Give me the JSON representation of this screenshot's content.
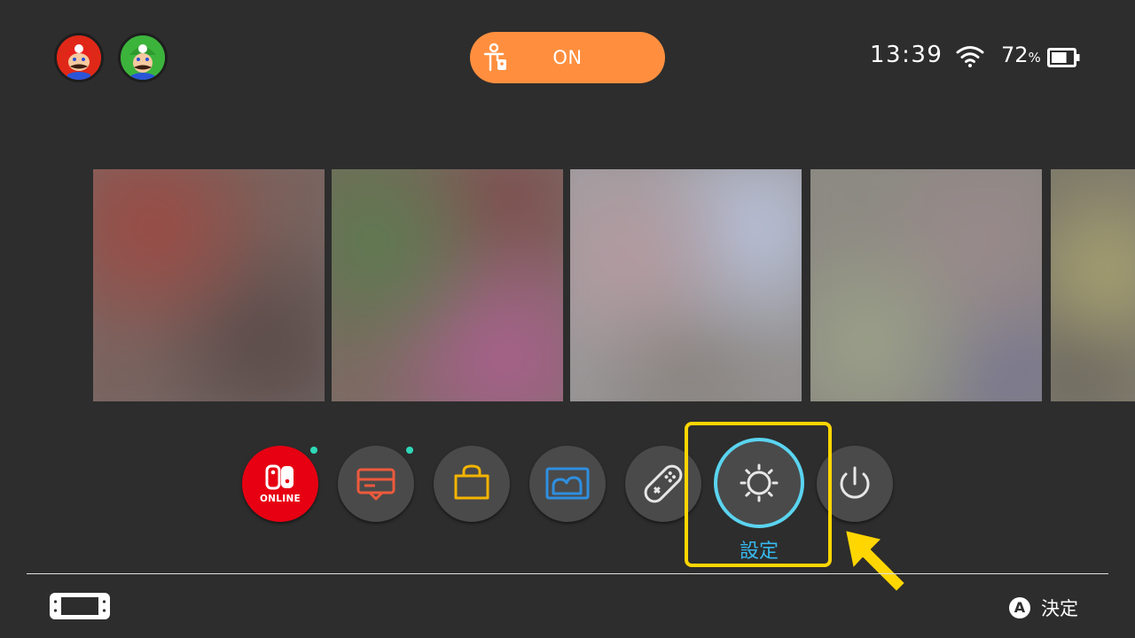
{
  "users": [
    {
      "name": "mario-avatar",
      "color": "#e02818"
    },
    {
      "name": "luigi-avatar",
      "color": "#3cb43c"
    }
  ],
  "parental_controls": {
    "label": "ON",
    "icon": "parental-controls-icon",
    "color": "#ff8f3f"
  },
  "status": {
    "time": "13:39",
    "battery_percent": "72",
    "battery_unit": "%",
    "battery_level": 0.72
  },
  "games": [
    {
      "name": "game-tile-1"
    },
    {
      "name": "game-tile-2"
    },
    {
      "name": "game-tile-3"
    },
    {
      "name": "game-tile-4"
    },
    {
      "name": "game-tile-5"
    }
  ],
  "dock": {
    "online": {
      "label": "ONLINE",
      "icon": "nintendo-switch-online-icon",
      "has_notice": true
    },
    "news": {
      "icon": "news-icon",
      "has_notice": true
    },
    "eshop": {
      "icon": "shopping-bag-icon"
    },
    "album": {
      "icon": "album-icon"
    },
    "controllers": {
      "icon": "controller-icon"
    },
    "settings": {
      "label": "設定",
      "icon": "gear-icon",
      "selected": true
    },
    "power": {
      "icon": "power-icon"
    }
  },
  "footer": {
    "console_icon": "console-icon",
    "confirm_button": "A",
    "confirm_label": "決定"
  },
  "colors": {
    "background": "#2d2d2d",
    "accent_blue": "#36b9ee",
    "highlight_yellow": "#ffd600",
    "online_red": "#e60012",
    "notice_dot": "#2fd8b8"
  }
}
